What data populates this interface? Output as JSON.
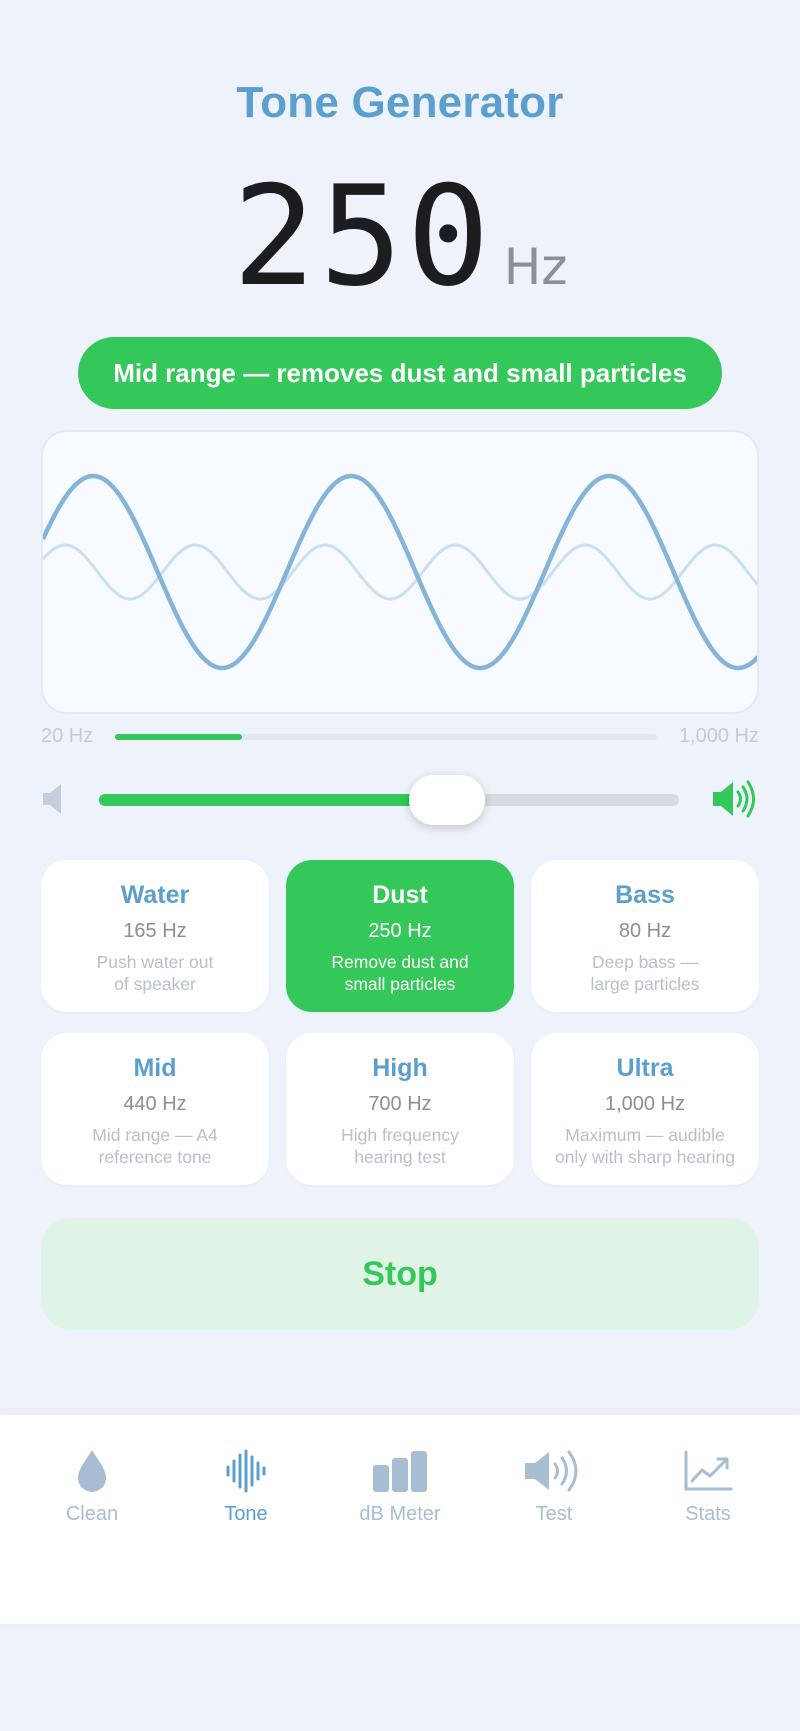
{
  "header": {
    "title": "Tone Generator"
  },
  "frequency": {
    "value": "250",
    "unit": "Hz"
  },
  "range_badge": {
    "text": "Mid range — removes dust and small particles"
  },
  "frequency_range": {
    "min_label": "20 Hz",
    "max_label": "1,000 Hz",
    "position": 0.235
  },
  "volume": {
    "level": 0.6
  },
  "presets": [
    {
      "name": "Water",
      "freq": "165 Hz",
      "desc_line1": "Push water out",
      "desc_line2": "of speaker",
      "active": false
    },
    {
      "name": "Dust",
      "freq": "250 Hz",
      "desc_line1": "Remove dust and",
      "desc_line2": "small particles",
      "active": true
    },
    {
      "name": "Bass",
      "freq": "80 Hz",
      "desc_line1": "Deep bass —",
      "desc_line2": "large particles",
      "active": false
    },
    {
      "name": "Mid",
      "freq": "440 Hz",
      "desc_line1": "Mid range — A4",
      "desc_line2": "reference tone",
      "active": false
    },
    {
      "name": "High",
      "freq": "700 Hz",
      "desc_line1": "High frequency",
      "desc_line2": "hearing test",
      "active": false
    },
    {
      "name": "Ultra",
      "freq": "1,000 Hz",
      "desc_line1": "Maximum — audible",
      "desc_line2": "only with sharp hearing",
      "active": false
    }
  ],
  "stop_button": {
    "label": "Stop"
  },
  "tabs": [
    {
      "label": "Clean",
      "icon": "droplet-icon",
      "active": false
    },
    {
      "label": "Tone",
      "icon": "waveform-icon",
      "active": true
    },
    {
      "label": "dB Meter",
      "icon": "bars-icon",
      "active": false
    },
    {
      "label": "Test",
      "icon": "speaker-wave-icon",
      "active": false
    },
    {
      "label": "Stats",
      "icon": "chart-up-icon",
      "active": false
    }
  ],
  "colors": {
    "accent_blue": "#5b9fcf",
    "accent_green": "#34c759",
    "wave_primary": "#84b4d9",
    "wave_secondary": "#c9e0f2",
    "tab_inactive": "#a6bdd3"
  }
}
